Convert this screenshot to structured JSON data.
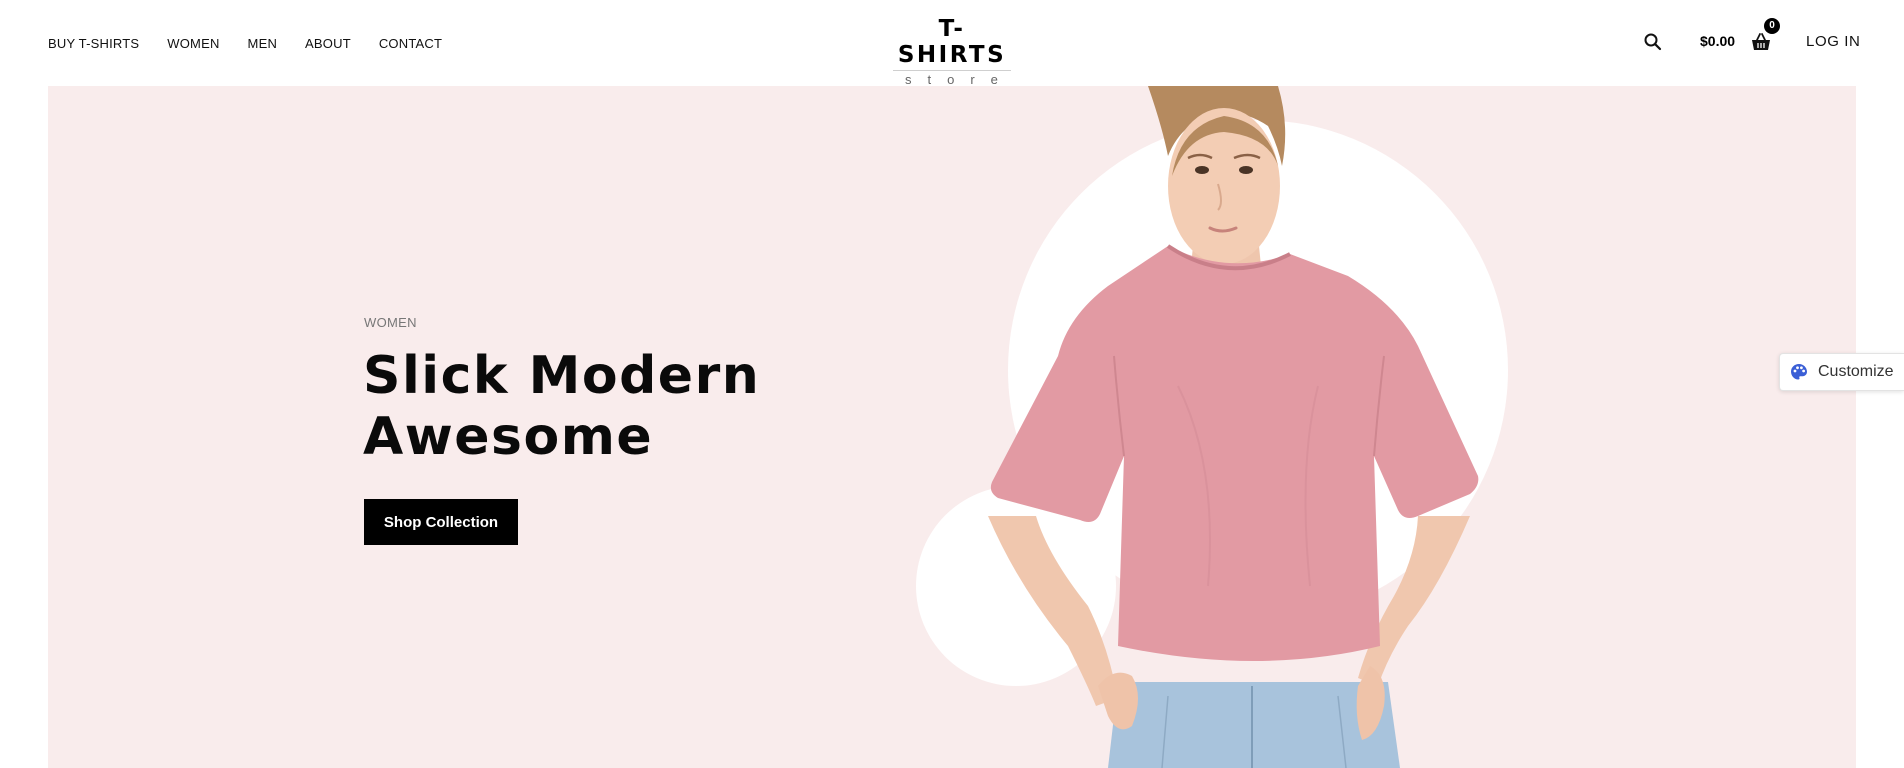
{
  "nav": {
    "items": [
      {
        "label": "BUY T-SHIRTS"
      },
      {
        "label": "WOMEN"
      },
      {
        "label": "MEN"
      },
      {
        "label": "ABOUT"
      },
      {
        "label": "CONTACT"
      }
    ]
  },
  "logo": {
    "title": "T-SHIRTS",
    "subtitle": "store"
  },
  "header_actions": {
    "search_icon": "search-icon",
    "cart_amount": "$0.00",
    "cart_icon": "basket-icon",
    "cart_count": "0",
    "login_label": "LOG IN"
  },
  "hero": {
    "eyebrow": "WOMEN",
    "title_line1": "Slick Modern",
    "title_line2": "Awesome",
    "cta_label": "Shop Collection",
    "background_color": "#f9ecec",
    "tshirt_color": "#e29aa3"
  },
  "customize": {
    "label": "Customize",
    "icon": "palette-icon",
    "icon_color": "#3b5fd6"
  }
}
